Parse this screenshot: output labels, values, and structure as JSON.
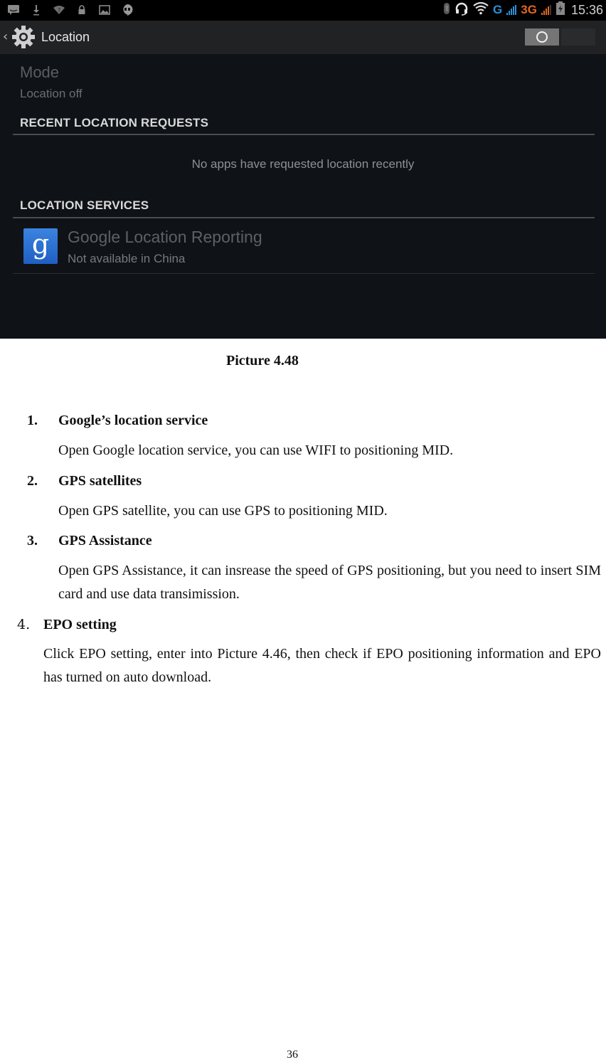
{
  "screenshot": {
    "status_bar": {
      "left_icons": [
        "message-icon",
        "download-icon",
        "wifi-question-icon",
        "lock-icon",
        "image-icon",
        "hangouts-icon"
      ],
      "right_icons": [
        "bluetooth-icon",
        "headset-icon",
        "wifi-icon"
      ],
      "network_g": "G",
      "network_3g": "3G",
      "time": "15:36",
      "colors": {
        "g": "#2f8fd8",
        "3g": "#e0661e"
      }
    },
    "action_bar": {
      "back_glyph": "‹",
      "title": "Location",
      "toggle_state": "off"
    },
    "mode": {
      "title": "Mode",
      "value": "Location off"
    },
    "recent_requests": {
      "header": "RECENT LOCATION REQUESTS",
      "empty_message": "No apps have requested location recently"
    },
    "location_services": {
      "header": "LOCATION SERVICES",
      "items": [
        {
          "icon": "g",
          "title": "Google Location Reporting",
          "subtitle": "Not available in China"
        }
      ]
    }
  },
  "document": {
    "caption": "Picture 4.48",
    "items": [
      {
        "number": "1.",
        "heading": "Google’s location service",
        "body": "Open Google location service, you can use WIFI to positioning MID."
      },
      {
        "number": "2.",
        "heading": "GPS satellites",
        "body": "Open GPS satellite, you can use GPS to positioning MID."
      },
      {
        "number": "3.",
        "heading": "GPS Assistance",
        "body": "Open GPS Assistance, it can insrease the speed of GPS positioning, but you need to insert SIM card and use data transimission."
      },
      {
        "number": "4.",
        "heading": "EPO setting",
        "body": "Click EPO setting, enter into Picture 4.46, then check if EPO positioning information and EPO has turned on auto download."
      }
    ],
    "page_number": "36"
  }
}
